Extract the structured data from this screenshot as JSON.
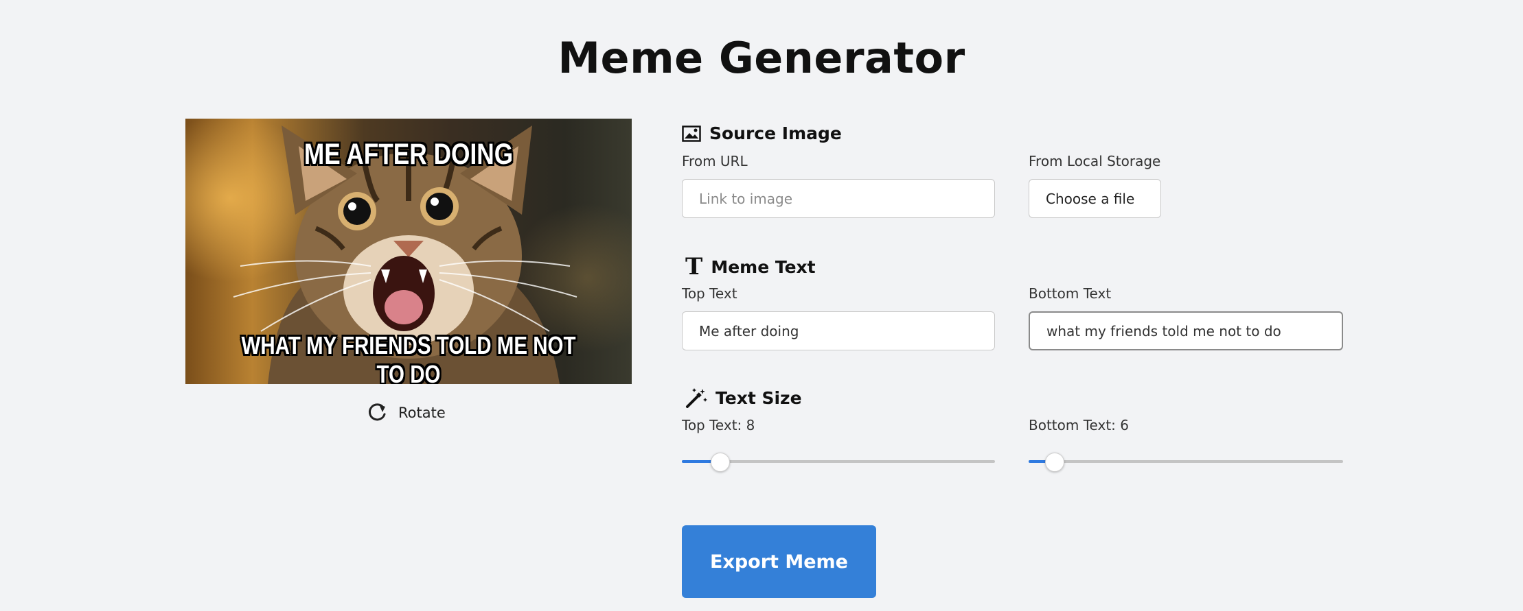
{
  "page": {
    "title": "Meme Generator"
  },
  "preview": {
    "top_text": "ME AFTER DOING",
    "bottom_text": "WHAT MY FRIENDS TOLD ME NOT TO DO",
    "rotate_label": "Rotate",
    "rotate_icon": "rotate-clockwise-icon"
  },
  "source_image": {
    "title": "Source Image",
    "icon": "image-icon",
    "url_label": "From URL",
    "url_placeholder": "Link to image",
    "url_value": "",
    "local_label": "From Local Storage",
    "file_button_label": "Choose a file"
  },
  "meme_text": {
    "title": "Meme Text",
    "icon": "text-t-icon",
    "top_label": "Top Text",
    "top_value": "Me after doing",
    "bottom_label": "Bottom Text",
    "bottom_value": "what my friends told me not to do"
  },
  "text_size": {
    "title": "Text Size",
    "icon": "magic-wand-icon",
    "top_label": "Top Text: 8",
    "top_value": 8,
    "top_fraction": 0.12,
    "bottom_label": "Bottom Text: 6",
    "bottom_value": 6,
    "bottom_fraction": 0.08
  },
  "export": {
    "label": "Export Meme"
  },
  "colors": {
    "accent": "#3480d8",
    "slider_fill": "#2f7ae0",
    "background": "#f2f3f5"
  }
}
